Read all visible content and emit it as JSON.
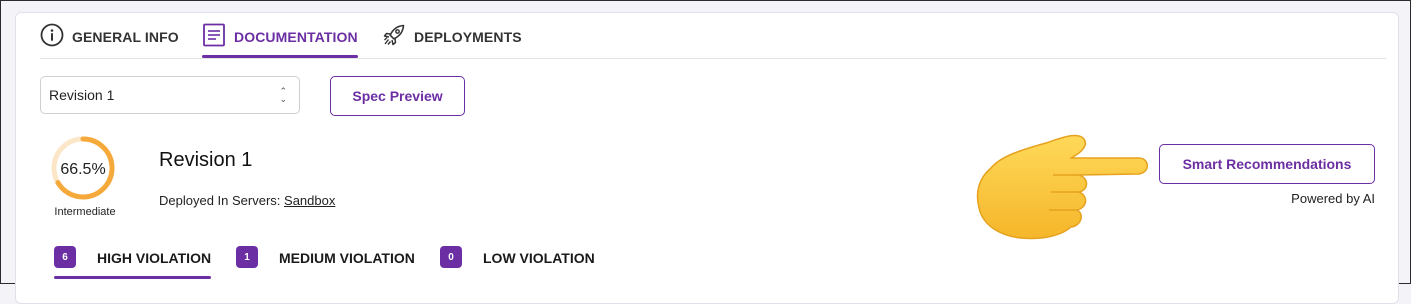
{
  "tabs": [
    {
      "label": "GENERAL INFO",
      "icon": "info-icon",
      "active": false
    },
    {
      "label": "DOCUMENTATION",
      "icon": "document-icon",
      "active": true
    },
    {
      "label": "DEPLOYMENTS",
      "icon": "rocket-icon",
      "active": false
    }
  ],
  "revision_select": {
    "value": "Revision 1"
  },
  "spec_preview_label": "Spec Preview",
  "score": {
    "value": "66.5%",
    "fraction": 0.665,
    "level": "Intermediate"
  },
  "revision": {
    "title": "Revision 1",
    "servers_label": "Deployed In Servers:",
    "servers_link": "Sandbox"
  },
  "smart": {
    "button_label": "Smart Recommendations",
    "powered_by": "Powered by AI"
  },
  "violations": [
    {
      "count": "6",
      "label": "HIGH VIOLATION",
      "active": true
    },
    {
      "count": "1",
      "label": "MEDIUM VIOLATION",
      "active": false
    },
    {
      "count": "0",
      "label": "LOW VIOLATION",
      "active": false
    }
  ],
  "colors": {
    "accent": "#6b2fa3",
    "gauge": "#f6a93b",
    "gauge_track": "#fbe7c8",
    "hand": "#f9c73c"
  }
}
